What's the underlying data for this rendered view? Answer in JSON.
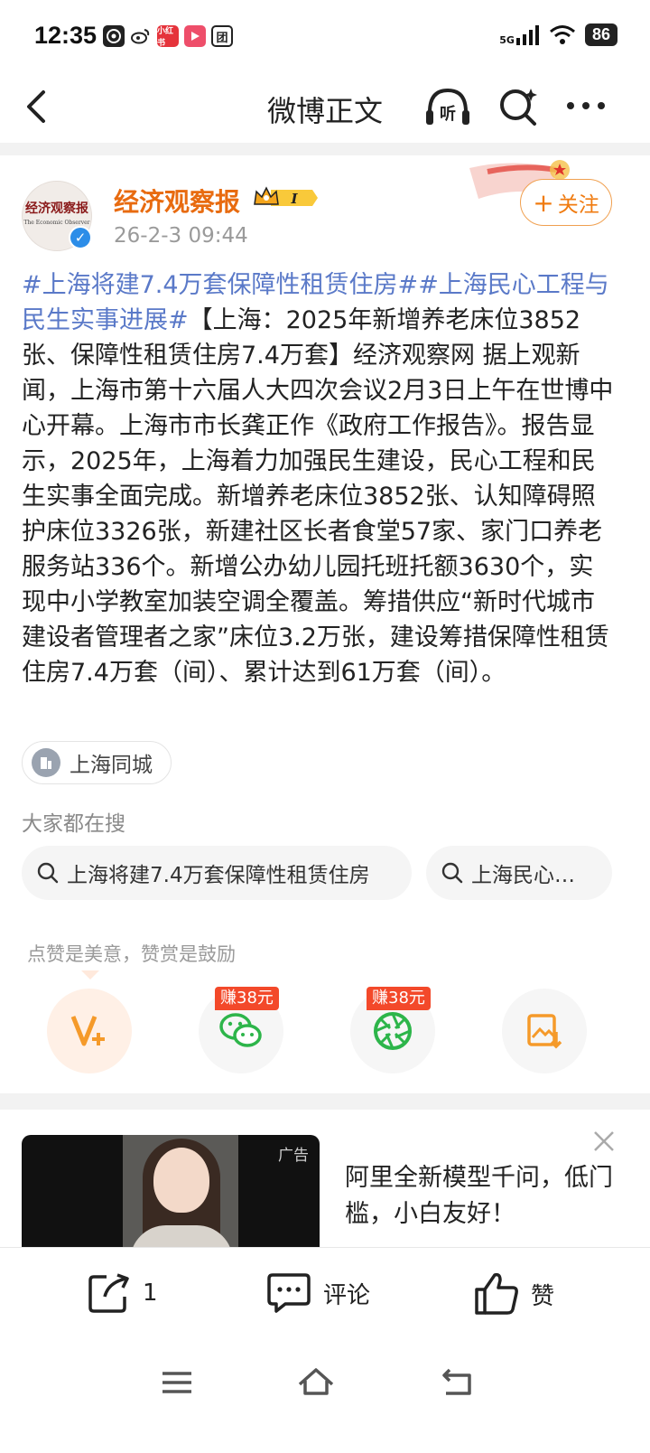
{
  "status_bar": {
    "time": "12:35",
    "network": "5G",
    "battery": "86",
    "app_icons": [
      "qq-icon",
      "weibo-icon",
      "xiaohongshu-icon",
      "video-icon",
      "tuan-icon"
    ]
  },
  "nav": {
    "title": "微博正文",
    "listen_label": "听"
  },
  "post": {
    "username": "经济观察报",
    "badge_level": "I",
    "timestamp": "26-2-3 09:44",
    "follow_label": "关注",
    "avatar_text": "经济观察报",
    "avatar_subtext": "The Economic Observer",
    "hashtag1": "#上海将建7.4万套保障性租赁住房#",
    "hashtag2": "#上海民心工程与民生实事进展#",
    "body": "【上海：2025年新增养老床位3852张、保障性租赁住房7.4万套】经济观察网 据上观新闻，上海市第十六届人大四次会议2月3日上午在世博中心开幕。上海市市长龚正作《政府工作报告》。报告显示，2025年，上海着力加强民生建设，民心工程和民生实事全面完成。新增养老床位3852张、认知障碍照护床位3326张，新建社区长者食堂57家、家门口养老服务站336个。新增公办幼儿园托班托额3630个，实现中小学教室加装空调全覆盖。筹措供应“新时代城市建设者管理者之家”床位3.2万张，建设筹措保障性租赁住房7.4万套（间）、累计达到61万套（间）。",
    "location": "上海同城"
  },
  "search": {
    "title": "大家都在搜",
    "chips": [
      "上海将建7.4万套保障性租赁住房",
      "上海民心…"
    ]
  },
  "reward": {
    "hint": "点赞是美意，赞赏是鼓励",
    "earn_tag": "赚38元"
  },
  "ad": {
    "label": "广告",
    "text": "阿里全新模型千问，低门槛，小白友好！"
  },
  "bottom_bar": {
    "share_count": "1",
    "comment_label": "评论",
    "like_label": "赞"
  },
  "colors": {
    "accent": "#f07b10",
    "hashtag": "#5a79c8",
    "username": "#e86b10"
  }
}
